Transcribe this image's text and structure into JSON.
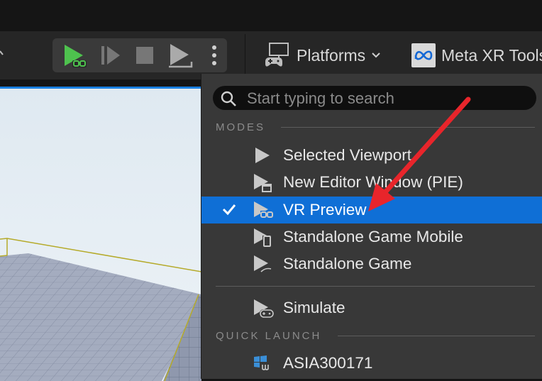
{
  "toolbar": {
    "platforms_label": "Platforms",
    "meta_label": "Meta XR Tools"
  },
  "menu": {
    "search_placeholder": "Start typing to search",
    "modes_header": "MODES",
    "modes": [
      {
        "label": "Selected Viewport",
        "checked": false,
        "icon": "play-icon"
      },
      {
        "label": "New Editor Window (PIE)",
        "checked": false,
        "icon": "editor-window-play-icon"
      },
      {
        "label": "VR Preview",
        "checked": true,
        "icon": "vr-headset-play-icon"
      },
      {
        "label": "Standalone Game Mobile",
        "checked": false,
        "icon": "mobile-play-icon"
      },
      {
        "label": "Standalone Game",
        "checked": false,
        "icon": "standalone-play-icon"
      }
    ],
    "simulate_label": "Simulate",
    "quick_launch_header": "QUICK LAUNCH",
    "quick_launch": [
      {
        "label": "ASIA300171",
        "icon": "windows-unreal-icon"
      }
    ]
  },
  "colors": {
    "accent": "#0f6fd6",
    "play_green": "#4ec24e",
    "annotation_arrow": "#e8252b"
  }
}
